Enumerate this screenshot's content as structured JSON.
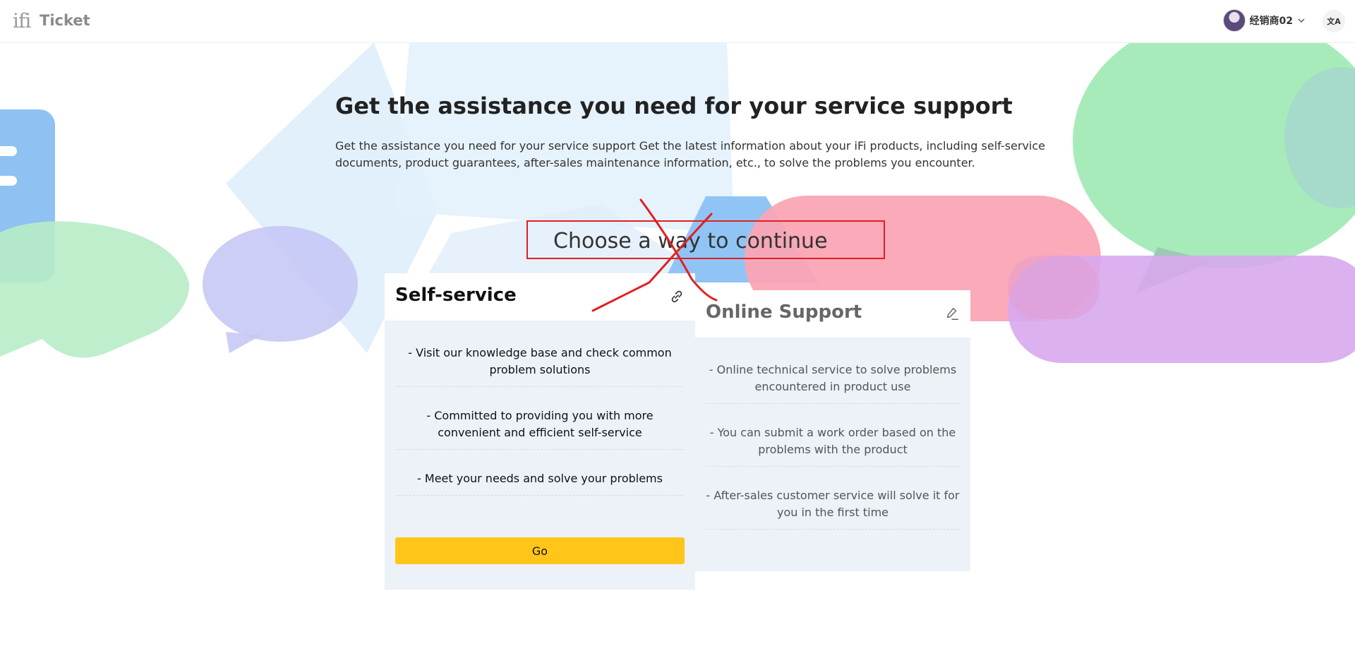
{
  "header": {
    "logo_mark": "ifi",
    "logo_text": "Ticket",
    "user_name": "经销商02",
    "lang_label": "文A"
  },
  "hero": {
    "title": "Get the assistance you need for your service support",
    "description": "Get the assistance you need for your service support Get the latest information about your iFi products, including self-service documents, product guarantees, after-sales maintenance information, etc., to solve the problems you encounter."
  },
  "choose_prompt": "Choose a way to continue",
  "self_service": {
    "title": "Self-service",
    "icon": "link-icon",
    "features": [
      "- Visit our knowledge base and check common problem solutions",
      "- Committed to providing you with more convenient and efficient self-service",
      "- Meet your needs and solve your problems"
    ],
    "button_label": "Go"
  },
  "online_support": {
    "title": "Online Support",
    "icon": "edit-icon",
    "features": [
      "- Online technical service to solve problems encountered in product use",
      "- You can submit a work order based on the problems with the product",
      "- After-sales customer service will solve it for you in the first time"
    ]
  },
  "colors": {
    "accent_button": "#ffc619",
    "card_body": "#edf1f8",
    "annotation": "#e02020"
  }
}
